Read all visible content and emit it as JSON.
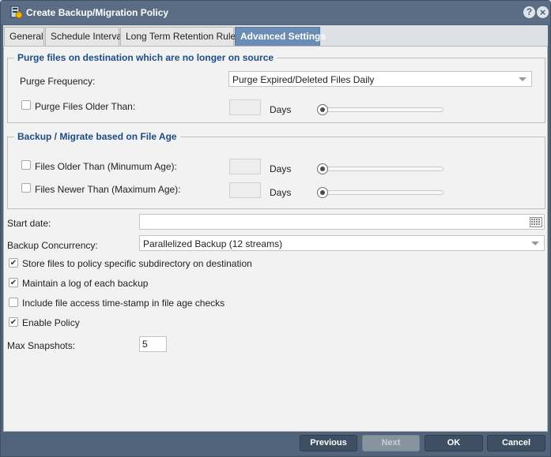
{
  "window": {
    "title": "Create Backup/Migration Policy"
  },
  "tabs": [
    {
      "label": "General"
    },
    {
      "label": "Schedule Interval"
    },
    {
      "label": "Long Term Retention Rules"
    },
    {
      "label": "Advanced Settings"
    }
  ],
  "purge": {
    "legend": "Purge files on destination which are no longer on source",
    "frequency_label": "Purge Frequency:",
    "frequency_value": "Purge Expired/Deleted Files Daily",
    "older_than_label": "Purge Files Older Than:",
    "older_than_checked": false,
    "days_label": "Days"
  },
  "file_age": {
    "legend": "Backup / Migrate based on File Age",
    "older_label": "Files Older Than (Minumum Age):",
    "older_checked": false,
    "newer_label": "Files Newer Than (Maximum Age):",
    "newer_checked": false,
    "days_label": "Days"
  },
  "start_date": {
    "label": "Start date:",
    "value": ""
  },
  "concurrency": {
    "label": "Backup Concurrency:",
    "value": "Parallelized Backup (12 streams)"
  },
  "options": [
    {
      "label": "Store files to policy specific subdirectory on destination",
      "checked": true
    },
    {
      "label": "Maintain a log of each backup",
      "checked": true
    },
    {
      "label": "Include file access time-stamp in file age checks",
      "checked": false
    },
    {
      "label": "Enable Policy",
      "checked": true
    }
  ],
  "max_snapshots": {
    "label": "Max Snapshots:",
    "value": "5"
  },
  "footer": {
    "previous": "Previous",
    "next": "Next",
    "ok": "OK",
    "cancel": "Cancel"
  },
  "icons": {
    "title": "backup-policy-icon",
    "help": "help-icon",
    "close": "close-icon",
    "calendar": "calendar-icon"
  }
}
